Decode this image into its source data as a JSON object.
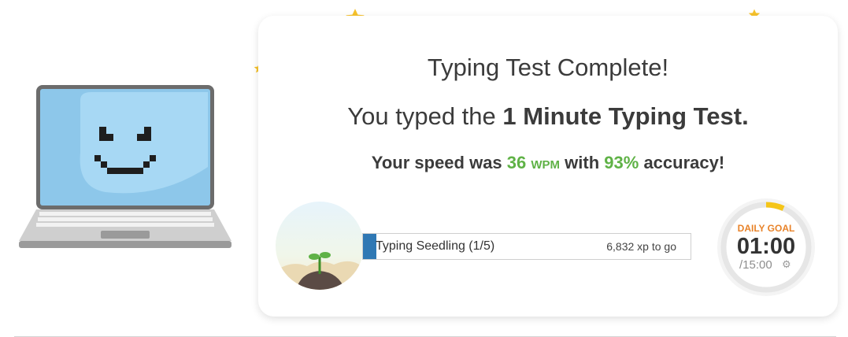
{
  "card": {
    "title": "Typing Test Complete!",
    "subtitle_prefix": "You typed the ",
    "subtitle_test": "1 Minute Typing Test.",
    "speed_prefix": "Your speed was ",
    "speed_value": "36",
    "speed_unit": "WPM",
    "speed_mid": " with ",
    "accuracy_value": "93%",
    "accuracy_suffix": " accuracy!"
  },
  "level": {
    "label": "Typing Seedling (1/5)",
    "xp_to_go": "6,832 xp to go",
    "progress_fraction": 0.04,
    "bar_color": "#2f78b4"
  },
  "daily_goal": {
    "title": "DAILY GOAL",
    "time": "01:00",
    "target": "/15:00",
    "progress_fraction": 0.067,
    "ring_color": "#f5c518",
    "settings_icon": "gear-icon"
  },
  "colors": {
    "accent_green": "#5fb246",
    "goal_orange": "#e8832a",
    "text_dark": "#3b3b3b"
  }
}
